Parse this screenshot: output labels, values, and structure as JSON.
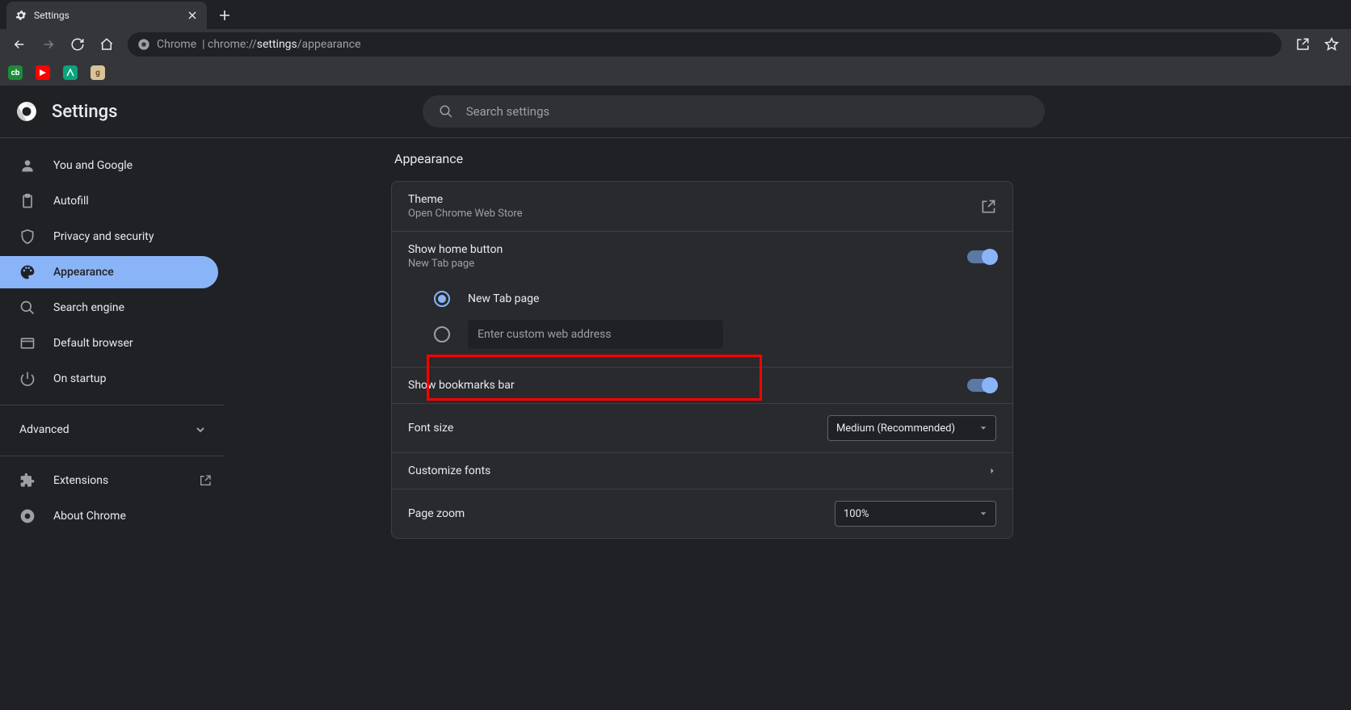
{
  "tab": {
    "title": "Settings"
  },
  "url": {
    "origin": "Chrome",
    "path1": "chrome://",
    "path2": "settings",
    "path3": "/appearance"
  },
  "header": {
    "title": "Settings",
    "search_placeholder": "Search settings"
  },
  "sidebar": {
    "items": [
      {
        "label": "You and Google"
      },
      {
        "label": "Autofill"
      },
      {
        "label": "Privacy and security"
      },
      {
        "label": "Appearance"
      },
      {
        "label": "Search engine"
      },
      {
        "label": "Default browser"
      },
      {
        "label": "On startup"
      }
    ],
    "advanced": "Advanced",
    "extensions": "Extensions",
    "about": "About Chrome"
  },
  "section": {
    "title": "Appearance",
    "theme": {
      "title": "Theme",
      "sub": "Open Chrome Web Store"
    },
    "home": {
      "title": "Show home button",
      "sub": "New Tab page",
      "opt1": "New Tab page",
      "custom_placeholder": "Enter custom web address"
    },
    "bookmarks": {
      "title": "Show bookmarks bar"
    },
    "font_size": {
      "title": "Font size",
      "value": "Medium (Recommended)"
    },
    "custom_fonts": {
      "title": "Customize fonts"
    },
    "zoom": {
      "title": "Page zoom",
      "value": "100%"
    }
  }
}
